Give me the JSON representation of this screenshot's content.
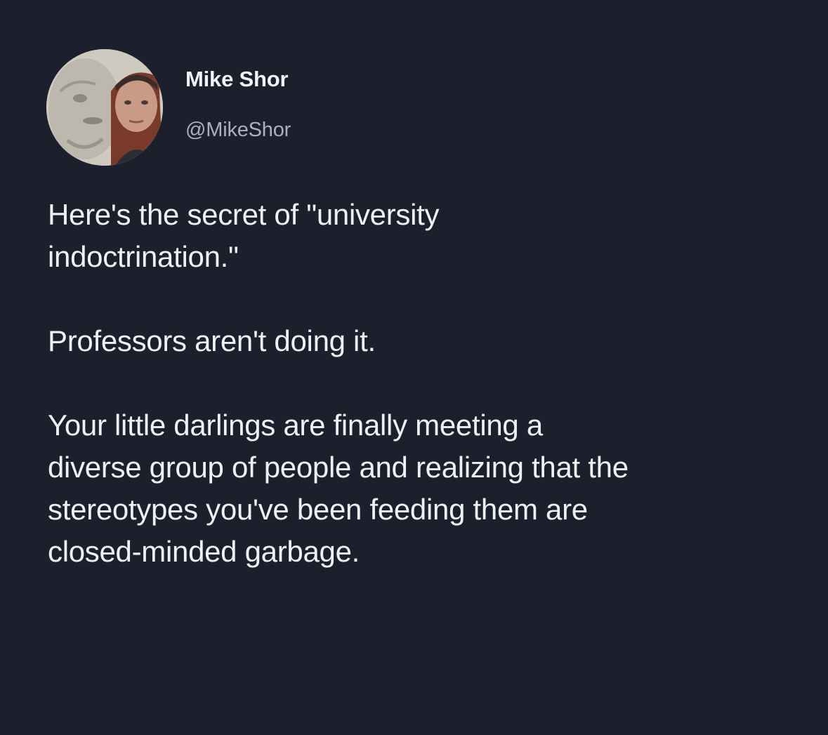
{
  "tweet": {
    "author": {
      "display_name": "Mike Shor",
      "handle": "@MikeShor",
      "avatar_icon": "profile-photo"
    },
    "paragraphs": [
      "Here's the secret of \"university\nindoctrination.\"",
      "Professors aren't doing it.",
      "Your little darlings are finally meeting a\ndiverse group of people and realizing that the\nstereotypes you've been feeding them are\nclosed-minded garbage."
    ]
  },
  "colors": {
    "background": "#1b202c",
    "text": "#eef1f4",
    "handle": "#a9b1bb"
  }
}
